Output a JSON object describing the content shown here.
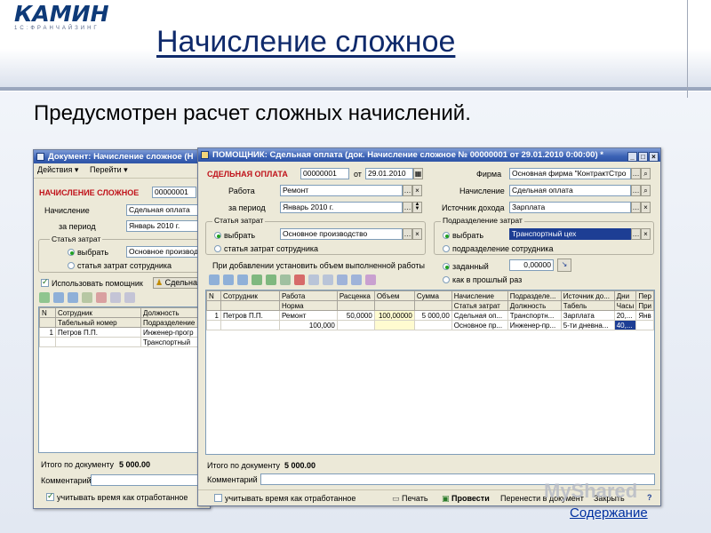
{
  "slide": {
    "logo": "КАМИН",
    "logo_sub": "1С:ФРАНЧАЙЗИНГ",
    "title": "Начисление сложное",
    "subtitle": "Предусмотрен расчет сложных начислений.",
    "link": "Содержание",
    "watermark": "MyShared"
  },
  "back_window": {
    "title": "Документ: Начисление сложное (Н",
    "menu": [
      "Действия ▾",
      "Перейти ▾"
    ],
    "doc_label": "НАЧИСЛЕНИЕ СЛОЖНОЕ",
    "doc_number": "00000001",
    "accrual_label": "Начисление",
    "accrual_value": "Сдельная оплата",
    "period_label": "за период",
    "period_value": "Январь 2010 г.",
    "cost_group": "Статья затрат",
    "radio_choose": "выбрать",
    "cost_value": "Основное производ",
    "radio_employee": "статья затрат сотрудника",
    "use_helper": "Использовать помощник",
    "helper_btn": "Сдельна",
    "columns": [
      "N",
      "Сотрудник",
      "Должность"
    ],
    "subcolumns": [
      "",
      "Табельный номер",
      "Подразделение"
    ],
    "rows": [
      {
        "n": "1",
        "employee": "Петров П.П.",
        "position": "Инженер-прогр",
        "dept": "Транспортный"
      }
    ],
    "total_label": "Итого по документу",
    "total_value": "5 000.00",
    "comment_label": "Комментарий",
    "time_label": "учитывать время как отработанное"
  },
  "front_window": {
    "title": "ПОМОЩНИК: Сдельная оплата (док. Начисление сложное № 00000001 от 29.01.2010 0:00:00) *",
    "header_label": "СДЕЛЬНАЯ ОПЛАТА",
    "number": "00000001",
    "from_label": "от",
    "date": "29.01.2010",
    "work_label": "Работа",
    "work_value": "Ремонт",
    "period_label": "за период",
    "period_value": "Январь 2010 г.",
    "cost_group": "Статья затрат",
    "radio_choose": "выбрать",
    "cost_value": "Основное производство",
    "radio_employee_cost": "статья затрат сотрудника",
    "firm_label": "Фирма",
    "firm_value": "Основная фирма \"КонтрактСтро",
    "accrual_label": "Начисление",
    "accrual_value": "Сдельная оплата",
    "income_label": "Источник дохода",
    "income_value": "Зарплата",
    "dept_group": "Подразделение затрат",
    "dept_value": "Транспортный цех",
    "radio_employee_dept": "подразделение сотрудника",
    "volume_note": "При добавлении установить объем выполненной работы",
    "radio_set": "заданный",
    "set_value": "0,00000",
    "radio_last": "как в прошлый раз",
    "columns": [
      "N",
      "Сотрудник",
      "Работа",
      "Расценка",
      "Объем",
      "Сумма",
      "Начисление",
      "Подразделе...",
      "Источник до...",
      "Дни",
      "Пер"
    ],
    "subcolumns": [
      "",
      "",
      "Норма",
      "",
      "",
      "",
      "Статья затрат",
      "Должность",
      "Табель",
      "Часы",
      "При"
    ],
    "row": {
      "n": "1",
      "employee": "Петров П.П.",
      "work": "Ремонт",
      "norm": "100,000",
      "rate": "50,0000",
      "volume": "100,00000",
      "sum": "5 000,00",
      "accrual": "Сдельная оп...",
      "cost": "Основное пр...",
      "dept": "Транспортн...",
      "position": "Инженер-пр...",
      "income": "Зарплата",
      "timesheet": "5-ти дневна...",
      "days": "20,...",
      "hours": "40,...",
      "per1": "Янв",
      "per2": ""
    },
    "total_label": "Итого по документу",
    "total_value": "5 000.00",
    "comment_label": "Комментарий",
    "time_label": "учитывать время как отработанное",
    "print_btn": "Печать",
    "post_btn": "Провести",
    "transfer_btn": "Перенести в документ",
    "close_btn": "Закрыть"
  },
  "colors": {
    "title_blue": "#0f2a6b",
    "accent_red": "#c0121a",
    "window_bg": "#ece9d8",
    "selection": "#1d3e94"
  }
}
